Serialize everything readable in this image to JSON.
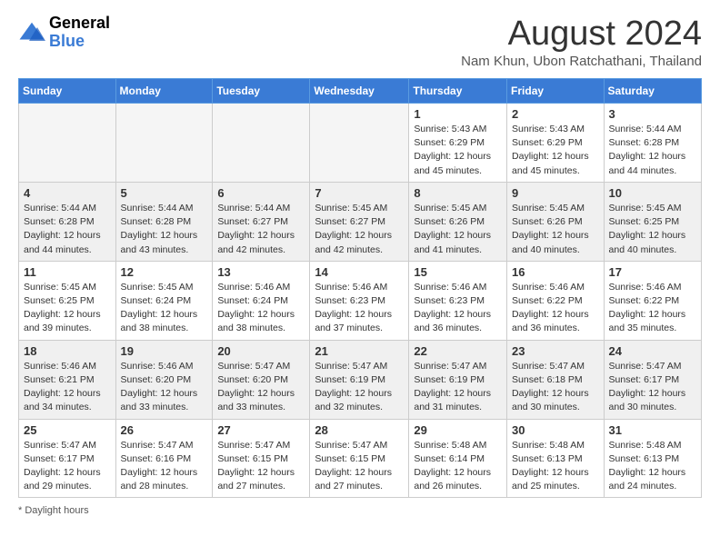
{
  "logo": {
    "line1": "General",
    "line2": "Blue"
  },
  "title": "August 2024",
  "subtitle": "Nam Khun, Ubon Ratchathani, Thailand",
  "days_of_week": [
    "Sunday",
    "Monday",
    "Tuesday",
    "Wednesday",
    "Thursday",
    "Friday",
    "Saturday"
  ],
  "footer_label": "Daylight hours",
  "weeks": [
    [
      {
        "day": "",
        "info": "",
        "empty": true
      },
      {
        "day": "",
        "info": "",
        "empty": true
      },
      {
        "day": "",
        "info": "",
        "empty": true
      },
      {
        "day": "",
        "info": "",
        "empty": true
      },
      {
        "day": "1",
        "info": "Sunrise: 5:43 AM\nSunset: 6:29 PM\nDaylight: 12 hours\nand 45 minutes."
      },
      {
        "day": "2",
        "info": "Sunrise: 5:43 AM\nSunset: 6:29 PM\nDaylight: 12 hours\nand 45 minutes."
      },
      {
        "day": "3",
        "info": "Sunrise: 5:44 AM\nSunset: 6:28 PM\nDaylight: 12 hours\nand 44 minutes."
      }
    ],
    [
      {
        "day": "4",
        "info": "Sunrise: 5:44 AM\nSunset: 6:28 PM\nDaylight: 12 hours\nand 44 minutes."
      },
      {
        "day": "5",
        "info": "Sunrise: 5:44 AM\nSunset: 6:28 PM\nDaylight: 12 hours\nand 43 minutes."
      },
      {
        "day": "6",
        "info": "Sunrise: 5:44 AM\nSunset: 6:27 PM\nDaylight: 12 hours\nand 42 minutes."
      },
      {
        "day": "7",
        "info": "Sunrise: 5:45 AM\nSunset: 6:27 PM\nDaylight: 12 hours\nand 42 minutes."
      },
      {
        "day": "8",
        "info": "Sunrise: 5:45 AM\nSunset: 6:26 PM\nDaylight: 12 hours\nand 41 minutes."
      },
      {
        "day": "9",
        "info": "Sunrise: 5:45 AM\nSunset: 6:26 PM\nDaylight: 12 hours\nand 40 minutes."
      },
      {
        "day": "10",
        "info": "Sunrise: 5:45 AM\nSunset: 6:25 PM\nDaylight: 12 hours\nand 40 minutes."
      }
    ],
    [
      {
        "day": "11",
        "info": "Sunrise: 5:45 AM\nSunset: 6:25 PM\nDaylight: 12 hours\nand 39 minutes."
      },
      {
        "day": "12",
        "info": "Sunrise: 5:45 AM\nSunset: 6:24 PM\nDaylight: 12 hours\nand 38 minutes."
      },
      {
        "day": "13",
        "info": "Sunrise: 5:46 AM\nSunset: 6:24 PM\nDaylight: 12 hours\nand 38 minutes."
      },
      {
        "day": "14",
        "info": "Sunrise: 5:46 AM\nSunset: 6:23 PM\nDaylight: 12 hours\nand 37 minutes."
      },
      {
        "day": "15",
        "info": "Sunrise: 5:46 AM\nSunset: 6:23 PM\nDaylight: 12 hours\nand 36 minutes."
      },
      {
        "day": "16",
        "info": "Sunrise: 5:46 AM\nSunset: 6:22 PM\nDaylight: 12 hours\nand 36 minutes."
      },
      {
        "day": "17",
        "info": "Sunrise: 5:46 AM\nSunset: 6:22 PM\nDaylight: 12 hours\nand 35 minutes."
      }
    ],
    [
      {
        "day": "18",
        "info": "Sunrise: 5:46 AM\nSunset: 6:21 PM\nDaylight: 12 hours\nand 34 minutes."
      },
      {
        "day": "19",
        "info": "Sunrise: 5:46 AM\nSunset: 6:20 PM\nDaylight: 12 hours\nand 33 minutes."
      },
      {
        "day": "20",
        "info": "Sunrise: 5:47 AM\nSunset: 6:20 PM\nDaylight: 12 hours\nand 33 minutes."
      },
      {
        "day": "21",
        "info": "Sunrise: 5:47 AM\nSunset: 6:19 PM\nDaylight: 12 hours\nand 32 minutes."
      },
      {
        "day": "22",
        "info": "Sunrise: 5:47 AM\nSunset: 6:19 PM\nDaylight: 12 hours\nand 31 minutes."
      },
      {
        "day": "23",
        "info": "Sunrise: 5:47 AM\nSunset: 6:18 PM\nDaylight: 12 hours\nand 30 minutes."
      },
      {
        "day": "24",
        "info": "Sunrise: 5:47 AM\nSunset: 6:17 PM\nDaylight: 12 hours\nand 30 minutes."
      }
    ],
    [
      {
        "day": "25",
        "info": "Sunrise: 5:47 AM\nSunset: 6:17 PM\nDaylight: 12 hours\nand 29 minutes."
      },
      {
        "day": "26",
        "info": "Sunrise: 5:47 AM\nSunset: 6:16 PM\nDaylight: 12 hours\nand 28 minutes."
      },
      {
        "day": "27",
        "info": "Sunrise: 5:47 AM\nSunset: 6:15 PM\nDaylight: 12 hours\nand 27 minutes."
      },
      {
        "day": "28",
        "info": "Sunrise: 5:47 AM\nSunset: 6:15 PM\nDaylight: 12 hours\nand 27 minutes."
      },
      {
        "day": "29",
        "info": "Sunrise: 5:48 AM\nSunset: 6:14 PM\nDaylight: 12 hours\nand 26 minutes."
      },
      {
        "day": "30",
        "info": "Sunrise: 5:48 AM\nSunset: 6:13 PM\nDaylight: 12 hours\nand 25 minutes."
      },
      {
        "day": "31",
        "info": "Sunrise: 5:48 AM\nSunset: 6:13 PM\nDaylight: 12 hours\nand 24 minutes."
      }
    ]
  ]
}
